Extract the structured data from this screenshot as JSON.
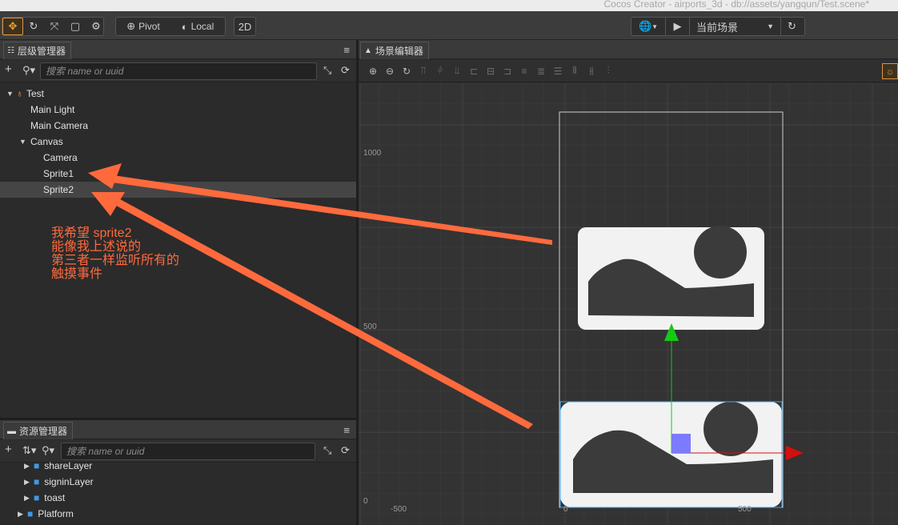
{
  "window": {
    "title": "Cocos Creator - airports_3d - db://assets/yangqun/Test.scene*"
  },
  "toolbar": {
    "pivot_label": "Pivot",
    "local_label": "Local",
    "mode_2d_label": "2D",
    "scene_select": "当前场景"
  },
  "hierarchy": {
    "tab_label": "层级管理器",
    "search_placeholder": "搜索 name or uuid",
    "items": [
      {
        "label": "Test"
      },
      {
        "label": "Main Light"
      },
      {
        "label": "Main Camera"
      },
      {
        "label": "Canvas"
      },
      {
        "label": "Camera"
      },
      {
        "label": "Sprite1"
      },
      {
        "label": "Sprite2"
      }
    ]
  },
  "annotation": {
    "lines": [
      "我希望 sprite2",
      "能像我上述说的",
      "第三者一样监听所有的",
      "触摸事件"
    ],
    "color": "#ff6a3d"
  },
  "assets": {
    "tab_label": "资源管理器",
    "search_placeholder": "搜索 name or uuid",
    "items": [
      {
        "label": "shareLayer"
      },
      {
        "label": "signinLayer"
      },
      {
        "label": "toast"
      },
      {
        "label": "Platform"
      }
    ]
  },
  "scene": {
    "tab_label": "场景编辑器",
    "y_labels": [
      "1000",
      "500",
      "0"
    ],
    "x_labels": [
      "-500",
      "0",
      "500"
    ]
  },
  "colors": {
    "accent": "#e4933b",
    "selection_outline": "#3fa9f5",
    "gizmo_y": "#17c917",
    "gizmo_x": "#d40f0f",
    "gizmo_center": "#7b7bff"
  }
}
